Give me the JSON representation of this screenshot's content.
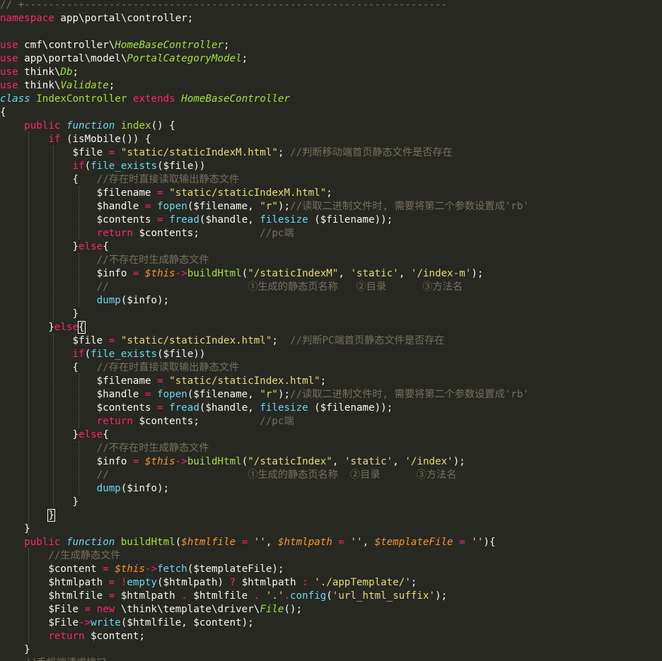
{
  "editor": {
    "language": "php",
    "theme": "monokai",
    "colors": {
      "background": "#272822",
      "foreground": "#f8f8f2",
      "comment": "#75715e",
      "keyword": "#f92672",
      "string": "#e6db74",
      "function": "#a6e22e",
      "builtin": "#66d9ef",
      "variable_param": "#fd971f"
    },
    "lines": [
      [
        [
          "// +----------------------------------------------------------------------",
          "cm"
        ]
      ],
      [
        [
          "namespace",
          "kw"
        ],
        [
          " app\\portal\\controller;",
          "tx"
        ]
      ],
      [],
      [
        [
          "use",
          "kw"
        ],
        [
          " cmf\\controller\\",
          "tx"
        ],
        [
          "HomeBaseController",
          "cls"
        ],
        [
          ";",
          "tx"
        ]
      ],
      [
        [
          "use",
          "kw"
        ],
        [
          " app\\portal\\model\\",
          "tx"
        ],
        [
          "PortalCategoryModel",
          "cls"
        ],
        [
          ";",
          "tx"
        ]
      ],
      [
        [
          "use",
          "kw"
        ],
        [
          " think\\",
          "tx"
        ],
        [
          "Db",
          "cls"
        ],
        [
          ";",
          "tx"
        ]
      ],
      [
        [
          "use",
          "kw"
        ],
        [
          " think\\",
          "tx"
        ],
        [
          "Validate",
          "cls"
        ],
        [
          ";",
          "tx"
        ]
      ],
      [
        [
          "class",
          "st2"
        ],
        [
          " IndexController ",
          "fn"
        ],
        [
          "extends",
          "kw"
        ],
        [
          " ",
          "tx"
        ],
        [
          "HomeBaseController",
          "cls"
        ]
      ],
      [
        [
          "{",
          "tx"
        ]
      ],
      [
        [
          "    ",
          "tx"
        ],
        [
          "public",
          "kw"
        ],
        [
          " ",
          "tx"
        ],
        [
          "function",
          "st2"
        ],
        [
          " ",
          "tx"
        ],
        [
          "index",
          "fn"
        ],
        [
          "() {",
          "tx"
        ]
      ],
      [
        [
          "        ",
          "tx"
        ],
        [
          "if",
          "kw"
        ],
        [
          " (isMobile()) {",
          "tx"
        ]
      ],
      [
        [
          "            $file ",
          "tx"
        ],
        [
          "=",
          "op"
        ],
        [
          " ",
          "tx"
        ],
        [
          "\"static/staticIndexM.html\"",
          "st"
        ],
        [
          "; ",
          "tx"
        ],
        [
          "//判断移动端首页静态文件是否存在",
          "cm"
        ]
      ],
      [
        [
          "            ",
          "tx"
        ],
        [
          "if",
          "kw"
        ],
        [
          "(",
          "tx"
        ],
        [
          "file_exists",
          "bi"
        ],
        [
          "($file))",
          "tx"
        ]
      ],
      [
        [
          "            {   ",
          "tx"
        ],
        [
          "//存在时直接读取输出静态文件",
          "cm"
        ]
      ],
      [
        [
          "                $filename ",
          "tx"
        ],
        [
          "=",
          "op"
        ],
        [
          " ",
          "tx"
        ],
        [
          "\"static/staticIndexM.html\"",
          "st"
        ],
        [
          ";",
          "tx"
        ]
      ],
      [
        [
          "                $handle ",
          "tx"
        ],
        [
          "=",
          "op"
        ],
        [
          " ",
          "tx"
        ],
        [
          "fopen",
          "bi"
        ],
        [
          "($filename, ",
          "tx"
        ],
        [
          "\"r\"",
          "st"
        ],
        [
          ");",
          "tx"
        ],
        [
          "//读取二进制文件时, 需要将第二个参数设置成'rb'",
          "cm"
        ]
      ],
      [
        [
          "                $contents ",
          "tx"
        ],
        [
          "=",
          "op"
        ],
        [
          " ",
          "tx"
        ],
        [
          "fread",
          "bi"
        ],
        [
          "($handle, ",
          "tx"
        ],
        [
          "filesize",
          "bi"
        ],
        [
          " ($filename));",
          "tx"
        ]
      ],
      [
        [
          "                ",
          "tx"
        ],
        [
          "return",
          "kw"
        ],
        [
          " $contents;          ",
          "tx"
        ],
        [
          "//pc端",
          "cm"
        ]
      ],
      [
        [
          "            }",
          "tx"
        ],
        [
          "else",
          "kw"
        ],
        [
          "{",
          "tx"
        ]
      ],
      [
        [
          "                ",
          "tx"
        ],
        [
          "//不存在时生成静态文件",
          "cm"
        ]
      ],
      [
        [
          "                $info ",
          "tx"
        ],
        [
          "=",
          "op"
        ],
        [
          " ",
          "tx"
        ],
        [
          "$this",
          "var"
        ],
        [
          "->",
          "op"
        ],
        [
          "buildHtml",
          "fn"
        ],
        [
          "(",
          "tx"
        ],
        [
          "\"/staticIndexM\"",
          "st"
        ],
        [
          ", ",
          "tx"
        ],
        [
          "'static'",
          "st"
        ],
        [
          ", ",
          "tx"
        ],
        [
          "'/index-m'",
          "st"
        ],
        [
          ");",
          "tx"
        ]
      ],
      [
        [
          "                ",
          "tx"
        ],
        [
          "//                       ①生成的静态页名称   ②目录      ③方法名",
          "cm"
        ]
      ],
      [
        [
          "                ",
          "tx"
        ],
        [
          "dump",
          "bi"
        ],
        [
          "($info);",
          "tx"
        ]
      ],
      [
        [
          "            }",
          "tx"
        ]
      ],
      [
        [
          "        }",
          "tx"
        ],
        [
          "else",
          "kw"
        ],
        [
          "{",
          "hl"
        ]
      ],
      [
        [
          "            $file ",
          "tx"
        ],
        [
          "=",
          "op"
        ],
        [
          " ",
          "tx"
        ],
        [
          "\"static/staticIndex.html\"",
          "st"
        ],
        [
          ";  ",
          "tx"
        ],
        [
          "//判断PC端首页静态文件是否存在",
          "cm"
        ]
      ],
      [
        [
          "            ",
          "tx"
        ],
        [
          "if",
          "kw"
        ],
        [
          "(",
          "tx"
        ],
        [
          "file_exists",
          "bi"
        ],
        [
          "($file))",
          "tx"
        ]
      ],
      [
        [
          "            {   ",
          "tx"
        ],
        [
          "//存在时直接读取输出静态文件",
          "cm"
        ]
      ],
      [
        [
          "                $filename ",
          "tx"
        ],
        [
          "=",
          "op"
        ],
        [
          " ",
          "tx"
        ],
        [
          "\"static/staticIndex.html\"",
          "st"
        ],
        [
          ";",
          "tx"
        ]
      ],
      [
        [
          "                $handle ",
          "tx"
        ],
        [
          "=",
          "op"
        ],
        [
          " ",
          "tx"
        ],
        [
          "fopen",
          "bi"
        ],
        [
          "($filename, ",
          "tx"
        ],
        [
          "\"r\"",
          "st"
        ],
        [
          ");",
          "tx"
        ],
        [
          "//读取二进制文件时, 需要将第二个参数设置成'rb'",
          "cm"
        ]
      ],
      [
        [
          "                $contents ",
          "tx"
        ],
        [
          "=",
          "op"
        ],
        [
          " ",
          "tx"
        ],
        [
          "fread",
          "bi"
        ],
        [
          "($handle, ",
          "tx"
        ],
        [
          "filesize",
          "bi"
        ],
        [
          " ($filename));",
          "tx"
        ]
      ],
      [
        [
          "                ",
          "tx"
        ],
        [
          "return",
          "kw"
        ],
        [
          " $contents;          ",
          "tx"
        ],
        [
          "//pc端",
          "cm"
        ]
      ],
      [
        [
          "            }",
          "tx"
        ],
        [
          "else",
          "kw"
        ],
        [
          "{",
          "tx"
        ]
      ],
      [
        [
          "                ",
          "tx"
        ],
        [
          "//不存在时生成静态文件",
          "cm"
        ]
      ],
      [
        [
          "                $info ",
          "tx"
        ],
        [
          "=",
          "op"
        ],
        [
          " ",
          "tx"
        ],
        [
          "$this",
          "var"
        ],
        [
          "->",
          "op"
        ],
        [
          "buildHtml",
          "fn"
        ],
        [
          "(",
          "tx"
        ],
        [
          "\"/staticIndex\"",
          "st"
        ],
        [
          ", ",
          "tx"
        ],
        [
          "'static'",
          "st"
        ],
        [
          ", ",
          "tx"
        ],
        [
          "'/index'",
          "st"
        ],
        [
          ");",
          "tx"
        ]
      ],
      [
        [
          "                ",
          "tx"
        ],
        [
          "//                       ①生成的静态页名称  ②目录      ③方法名",
          "cm"
        ]
      ],
      [
        [
          "                ",
          "tx"
        ],
        [
          "dump",
          "bi"
        ],
        [
          "($info);",
          "tx"
        ]
      ],
      [
        [
          "            }",
          "tx"
        ]
      ],
      [
        [
          "        ",
          "tx"
        ],
        [
          "}",
          "hl"
        ]
      ],
      [
        [
          "    }",
          "tx"
        ]
      ],
      [
        [
          "    ",
          "tx"
        ],
        [
          "public",
          "kw"
        ],
        [
          " ",
          "tx"
        ],
        [
          "function",
          "st2"
        ],
        [
          " ",
          "tx"
        ],
        [
          "buildHtml",
          "fn"
        ],
        [
          "(",
          "tx"
        ],
        [
          "$htmlfile",
          "var"
        ],
        [
          " ",
          "tx"
        ],
        [
          "=",
          "op"
        ],
        [
          " ",
          "tx"
        ],
        [
          "''",
          "st"
        ],
        [
          ", ",
          "tx"
        ],
        [
          "$htmlpath",
          "var"
        ],
        [
          " ",
          "tx"
        ],
        [
          "=",
          "op"
        ],
        [
          " ",
          "tx"
        ],
        [
          "''",
          "st"
        ],
        [
          ", ",
          "tx"
        ],
        [
          "$templateFile",
          "var"
        ],
        [
          " ",
          "tx"
        ],
        [
          "=",
          "op"
        ],
        [
          " ",
          "tx"
        ],
        [
          "''",
          "st"
        ],
        [
          "){",
          "tx"
        ]
      ],
      [
        [
          "        ",
          "tx"
        ],
        [
          "//生成静态文件",
          "cm"
        ]
      ],
      [
        [
          "        $content ",
          "tx"
        ],
        [
          "=",
          "op"
        ],
        [
          " ",
          "tx"
        ],
        [
          "$this",
          "var"
        ],
        [
          "->",
          "op"
        ],
        [
          "fetch",
          "bi"
        ],
        [
          "($templateFile);",
          "tx"
        ]
      ],
      [
        [
          "        $htmlpath ",
          "tx"
        ],
        [
          "=",
          "op"
        ],
        [
          " ",
          "tx"
        ],
        [
          "!",
          "op"
        ],
        [
          "empty",
          "bi"
        ],
        [
          "($htmlpath) ",
          "tx"
        ],
        [
          "?",
          "op"
        ],
        [
          " $htmlpath ",
          "tx"
        ],
        [
          ":",
          "op"
        ],
        [
          " ",
          "tx"
        ],
        [
          "'./appTemplate/'",
          "st"
        ],
        [
          ";",
          "tx"
        ]
      ],
      [
        [
          "        $htmlfile ",
          "tx"
        ],
        [
          "=",
          "op"
        ],
        [
          " $htmlpath ",
          "tx"
        ],
        [
          ".",
          "op"
        ],
        [
          " $htmlfile ",
          "tx"
        ],
        [
          ".",
          "op"
        ],
        [
          " ",
          "tx"
        ],
        [
          "'.'",
          "st"
        ],
        [
          ".",
          "op"
        ],
        [
          "config",
          "bi"
        ],
        [
          "(",
          "tx"
        ],
        [
          "'url_html_suffix'",
          "st"
        ],
        [
          ");",
          "tx"
        ]
      ],
      [
        [
          "        $File ",
          "tx"
        ],
        [
          "=",
          "op"
        ],
        [
          " ",
          "tx"
        ],
        [
          "new",
          "kw"
        ],
        [
          " \\think\\template\\driver\\",
          "tx"
        ],
        [
          "File",
          "cls"
        ],
        [
          "();",
          "tx"
        ]
      ],
      [
        [
          "        $File",
          "tx"
        ],
        [
          "->",
          "op"
        ],
        [
          "write",
          "bi"
        ],
        [
          "($htmlfile, $content);",
          "tx"
        ]
      ],
      [
        [
          "        ",
          "tx"
        ],
        [
          "return",
          "kw"
        ],
        [
          " $content;",
          "tx"
        ]
      ],
      [
        [
          "    }",
          "tx"
        ]
      ],
      [
        [
          "    ",
          "tx"
        ],
        [
          "//手机端请求接口",
          "cm"
        ]
      ]
    ]
  }
}
